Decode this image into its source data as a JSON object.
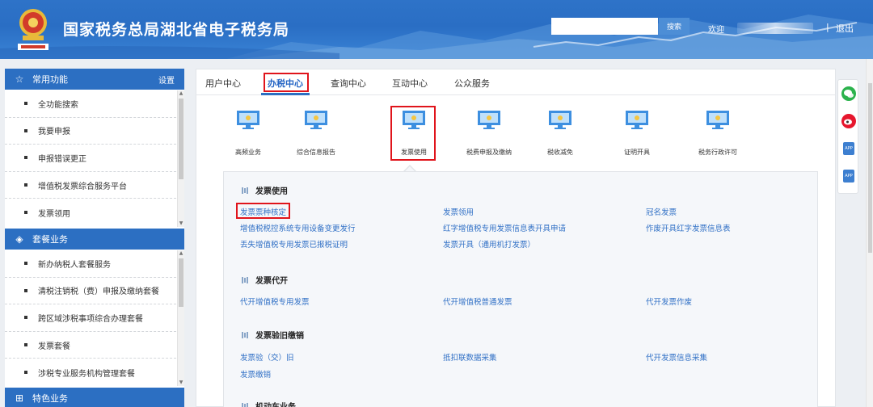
{
  "header": {
    "title": "国家税务总局湖北省电子税务局",
    "search_button": "搜索",
    "welcome": "欢迎",
    "separator": "|",
    "logout": "退出",
    "colors": {
      "header_bg": "#2e73c8",
      "accent": "#2c6fc2",
      "highlight": "#e0141b"
    }
  },
  "sidebar": {
    "common": {
      "title": "常用功能",
      "settings": "设置",
      "items": [
        "全功能搜索",
        "我要申报",
        "申报错误更正",
        "增值税发票综合服务平台",
        "发票领用"
      ]
    },
    "package": {
      "title": "套餐业务",
      "items": [
        "新办纳税人套餐服务",
        "清税注销税（费）申报及缴纳套餐",
        "跨区域涉税事项综合办理套餐",
        "发票套餐",
        "涉税专业服务机构管理套餐"
      ]
    },
    "special": {
      "title": "特色业务"
    }
  },
  "tabs": [
    "用户中心",
    "办税中心",
    "查询中心",
    "互动中心",
    "公众服务"
  ],
  "active_tab": "办税中心",
  "tiles": [
    "高频业务",
    "综合信息报告",
    "发票使用",
    "税费申报及缴纳",
    "税收减免",
    "证明开具",
    "税务行政许可"
  ],
  "active_tile": "发票使用",
  "sections": [
    {
      "title": "发票使用",
      "links": [
        "发票票种核定",
        "发票领用",
        "冠名发票",
        "增值税税控系统专用设备变更发行",
        "红字增值税专用发票信息表开具申请",
        "作废开具红字发票信息表",
        "丢失增值税专用发票已报税证明",
        "发票开具（通用机打发票）"
      ]
    },
    {
      "title": "发票代开",
      "links": [
        "代开增值税专用发票",
        "代开增值税普通发票",
        "代开发票作废"
      ]
    },
    {
      "title": "发票验旧缴销",
      "links": [
        "发票验（交）旧",
        "抵扣联数据采集",
        "代开发票信息采集",
        "发票缴销"
      ]
    },
    {
      "title": "机动车业务"
    }
  ],
  "right_tools": [
    "wechat-icon",
    "weibo-icon",
    "app-icon",
    "app-icon"
  ],
  "right_tool_labels": [
    "APP",
    "APP"
  ]
}
